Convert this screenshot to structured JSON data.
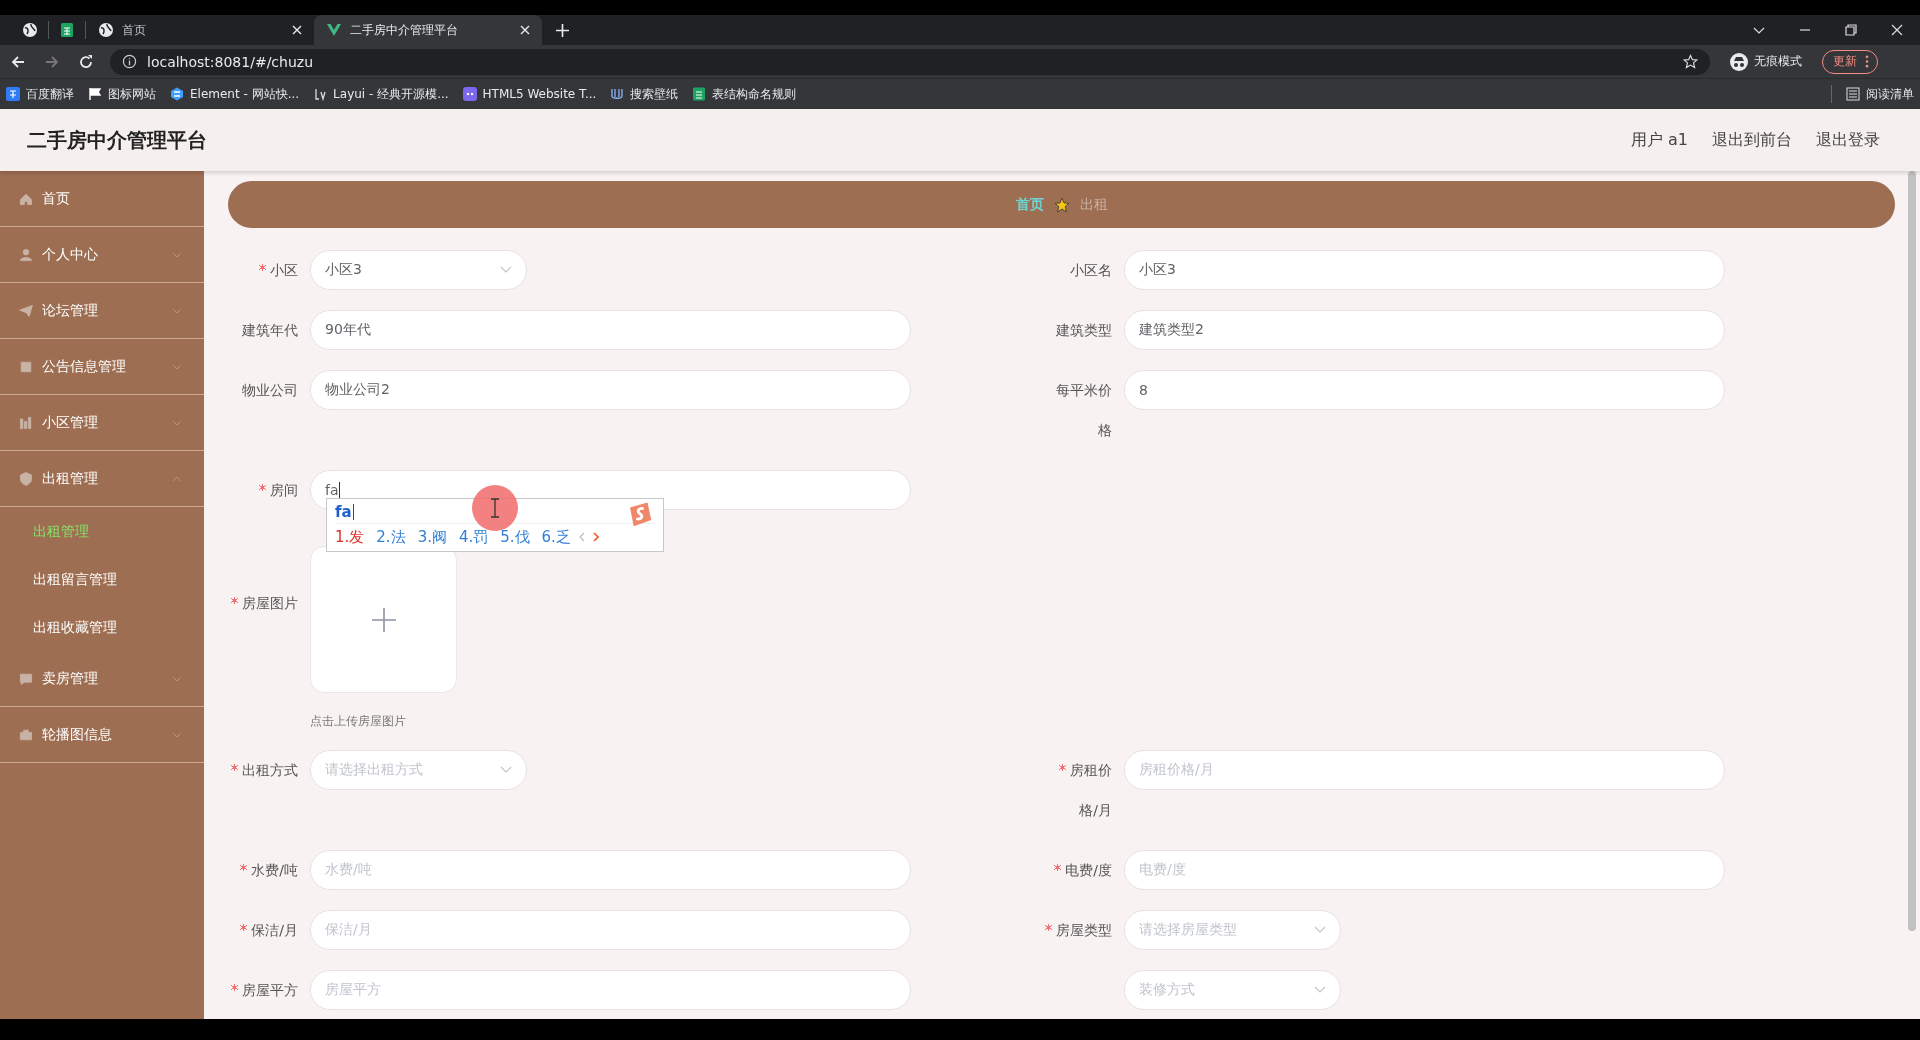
{
  "browser": {
    "tabs": [
      {
        "title": "首页",
        "selected": false
      },
      {
        "title": "二手房中介管理平台",
        "selected": true
      }
    ],
    "url": "localhost:8081/#/chuzu",
    "profile": "无痕模式",
    "update_button": "更新",
    "bookmarks": [
      {
        "label": "百度翻译"
      },
      {
        "label": "图标网站"
      },
      {
        "label": "Element - 网站快..."
      },
      {
        "label": "Layui - 经典开源模..."
      },
      {
        "label": "HTML5 Website T..."
      },
      {
        "label": "搜索壁纸"
      },
      {
        "label": "表结构命名规则"
      }
    ],
    "reading_list": "阅读清单"
  },
  "header": {
    "title": "二手房中介管理平台",
    "user": "用户 a1",
    "links": [
      "退出到前台",
      "退出登录"
    ]
  },
  "sidebar": {
    "items": [
      {
        "label": "首页",
        "kind": "link"
      },
      {
        "label": "个人中心",
        "kind": "menu",
        "expanded": false
      },
      {
        "label": "论坛管理",
        "kind": "menu",
        "expanded": false
      },
      {
        "label": "公告信息管理",
        "kind": "menu",
        "expanded": false
      },
      {
        "label": "小区管理",
        "kind": "menu",
        "expanded": false
      },
      {
        "label": "出租管理",
        "kind": "menu",
        "expanded": true,
        "children": [
          {
            "label": "出租管理",
            "selected": true
          },
          {
            "label": "出租留言管理",
            "selected": false
          },
          {
            "label": "出租收藏管理",
            "selected": false
          }
        ]
      },
      {
        "label": "卖房管理",
        "kind": "menu",
        "expanded": false
      },
      {
        "label": "轮播图信息",
        "kind": "menu",
        "expanded": false
      }
    ]
  },
  "breadcrumb": [
    "首页",
    "出租"
  ],
  "form": {
    "rows": [
      {
        "left": {
          "kind": "select",
          "label": "小区",
          "required": true,
          "value": "小区3"
        },
        "right": {
          "kind": "input",
          "label": "小区名",
          "required": false,
          "value": "小区3"
        }
      },
      {
        "left": {
          "kind": "input",
          "label": "建筑年代",
          "required": false,
          "value": "90年代"
        },
        "right": {
          "kind": "input",
          "label": "建筑类型",
          "required": false,
          "value": "建筑类型2"
        }
      },
      {
        "left": {
          "kind": "input",
          "label": "物业公司",
          "required": false,
          "value": "物业公司2"
        },
        "right": {
          "kind": "input",
          "label": "每平米价格",
          "required": false,
          "value": "8"
        }
      },
      {
        "left": {
          "kind": "input",
          "label": "房间",
          "required": true,
          "value": "fa",
          "ime": {
            "composition": "fa",
            "candidates": [
              {
                "text": "1.发",
                "selected": true
              },
              {
                "text": "2.法",
                "selected": false
              },
              {
                "text": "3.阀",
                "selected": false
              },
              {
                "text": "4.罚",
                "selected": false
              },
              {
                "text": "5.伐",
                "selected": false
              },
              {
                "text": "6.乏",
                "selected": false
              }
            ]
          }
        }
      },
      {
        "left": {
          "kind": "upload",
          "label": "房屋图片",
          "required": true,
          "hint": "点击上传房屋图片"
        }
      },
      {
        "left": {
          "kind": "select",
          "label": "出租方式",
          "required": true,
          "placeholder": "请选择出租方式"
        },
        "right": {
          "kind": "input",
          "label": "房租价格/月",
          "required": true,
          "placeholder": "房租价格/月"
        }
      },
      {
        "left": {
          "kind": "input",
          "label": "水费/吨",
          "required": true,
          "placeholder": "水费/吨"
        },
        "right": {
          "kind": "input",
          "label": "电费/度",
          "required": true,
          "placeholder": "电费/度"
        }
      },
      {
        "left": {
          "kind": "input",
          "label": "保洁/月",
          "required": true,
          "placeholder": "保洁/月"
        },
        "right": {
          "kind": "select",
          "label": "房屋类型",
          "required": true,
          "placeholder": "请选择房屋类型"
        }
      },
      {
        "left": {
          "kind": "input",
          "label": "房屋平方",
          "required": true,
          "placeholder": "房屋平方"
        },
        "right": {
          "kind": "select",
          "placeholder": "装修方式"
        }
      }
    ]
  }
}
